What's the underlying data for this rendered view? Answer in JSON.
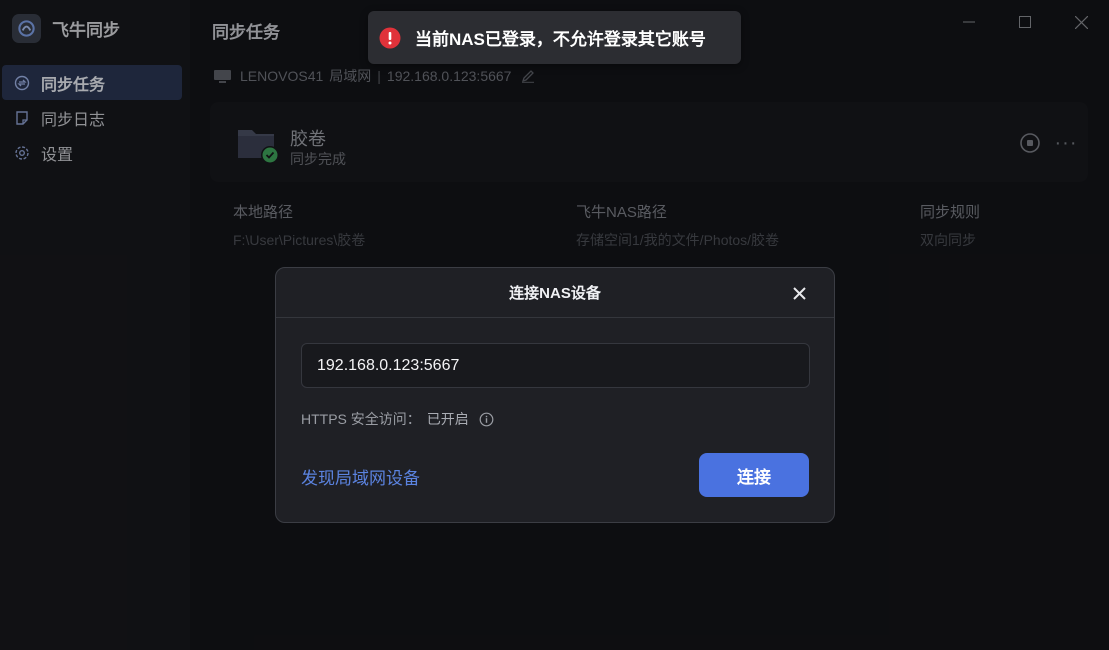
{
  "app": {
    "name": "飞牛同步"
  },
  "sidebar": {
    "items": [
      {
        "label": "同步任务",
        "icon": "sync-task-icon",
        "active": true
      },
      {
        "label": "同步日志",
        "icon": "log-icon",
        "active": false
      },
      {
        "label": "设置",
        "icon": "settings-gear-icon",
        "active": false
      }
    ]
  },
  "main": {
    "title": "同步任务",
    "device": {
      "name": "LENOVOS41",
      "network": "局域网",
      "address": "192.168.0.123:5667"
    },
    "task": {
      "name": "胶卷",
      "status": "同步完成",
      "status_color": "#3fa25a"
    },
    "info": {
      "local_label": "本地路径",
      "local_value": "F:\\User\\Pictures\\胶卷",
      "nas_label": "飞牛NAS路径",
      "nas_value": "存储空间1/我的文件/Photos/胶卷",
      "rule_label": "同步规则",
      "rule_value": "双向同步"
    }
  },
  "dialog": {
    "title": "连接NAS设备",
    "ip_value": "192.168.0.123:5667",
    "https_label": "HTTPS 安全访问：",
    "https_status": "已开启",
    "discover_link": "发现局域网设备",
    "connect_button": "连接",
    "accent": "#4a72e0"
  },
  "toast": {
    "message": "当前NAS已登录，不允许登录其它账号",
    "icon_color": "#e0323a"
  }
}
